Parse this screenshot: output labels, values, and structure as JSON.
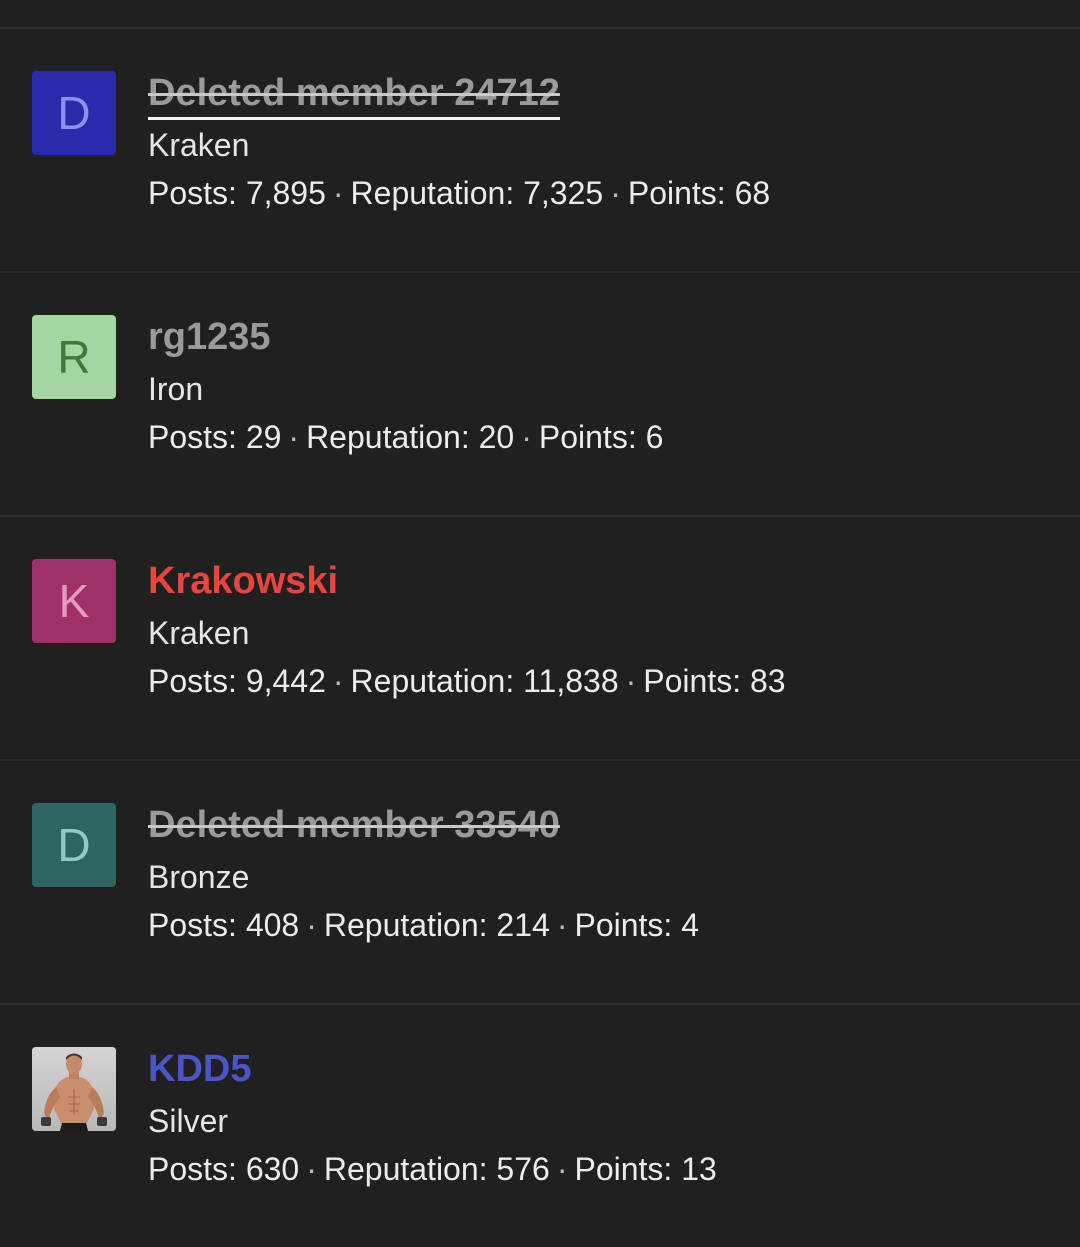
{
  "members": [
    {
      "avatar_letter": "D",
      "avatar_bg": "#2a2aac",
      "avatar_fg": "#8f8ff0",
      "avatar_type": "letter",
      "username": "Deleted member 24712",
      "username_color": "#9a9a9a",
      "deleted": true,
      "focused": true,
      "user_title": "Kraken",
      "posts_label": "Posts:",
      "posts": "7,895",
      "reputation_label": "Reputation:",
      "reputation": "7,325",
      "points_label": "Points:",
      "points": "68"
    },
    {
      "avatar_letter": "R",
      "avatar_bg": "#a3d6a0",
      "avatar_fg": "#3d7a38",
      "avatar_type": "letter",
      "username": "rg1235",
      "username_color": "#9a9a9a",
      "deleted": false,
      "focused": false,
      "user_title": "Iron",
      "posts_label": "Posts:",
      "posts": "29",
      "reputation_label": "Reputation:",
      "reputation": "20",
      "points_label": "Points:",
      "points": "6"
    },
    {
      "avatar_letter": "K",
      "avatar_bg": "#9e3168",
      "avatar_fg": "#e59ac0",
      "avatar_type": "letter",
      "username": "Krakowski",
      "username_color": "#e8453c",
      "deleted": false,
      "focused": false,
      "user_title": "Kraken",
      "posts_label": "Posts:",
      "posts": "9,442",
      "reputation_label": "Reputation:",
      "reputation": "11,838",
      "points_label": "Points:",
      "points": "83"
    },
    {
      "avatar_letter": "D",
      "avatar_bg": "#2e6563",
      "avatar_fg": "#8dcbc7",
      "avatar_type": "letter",
      "username": "Deleted member 33540",
      "username_color": "#9a9a9a",
      "deleted": true,
      "focused": false,
      "user_title": "Bronze",
      "posts_label": "Posts:",
      "posts": "408",
      "reputation_label": "Reputation:",
      "reputation": "214",
      "points_label": "Points:",
      "points": "4"
    },
    {
      "avatar_letter": "",
      "avatar_bg": "#c8c8c8",
      "avatar_fg": "#c8c8c8",
      "avatar_type": "photo",
      "username": "KDD5",
      "username_color": "#4a55c8",
      "deleted": false,
      "focused": false,
      "user_title": "Silver",
      "posts_label": "Posts:",
      "posts": "630",
      "reputation_label": "Reputation:",
      "reputation": "576",
      "points_label": "Points:",
      "points": "13"
    }
  ]
}
